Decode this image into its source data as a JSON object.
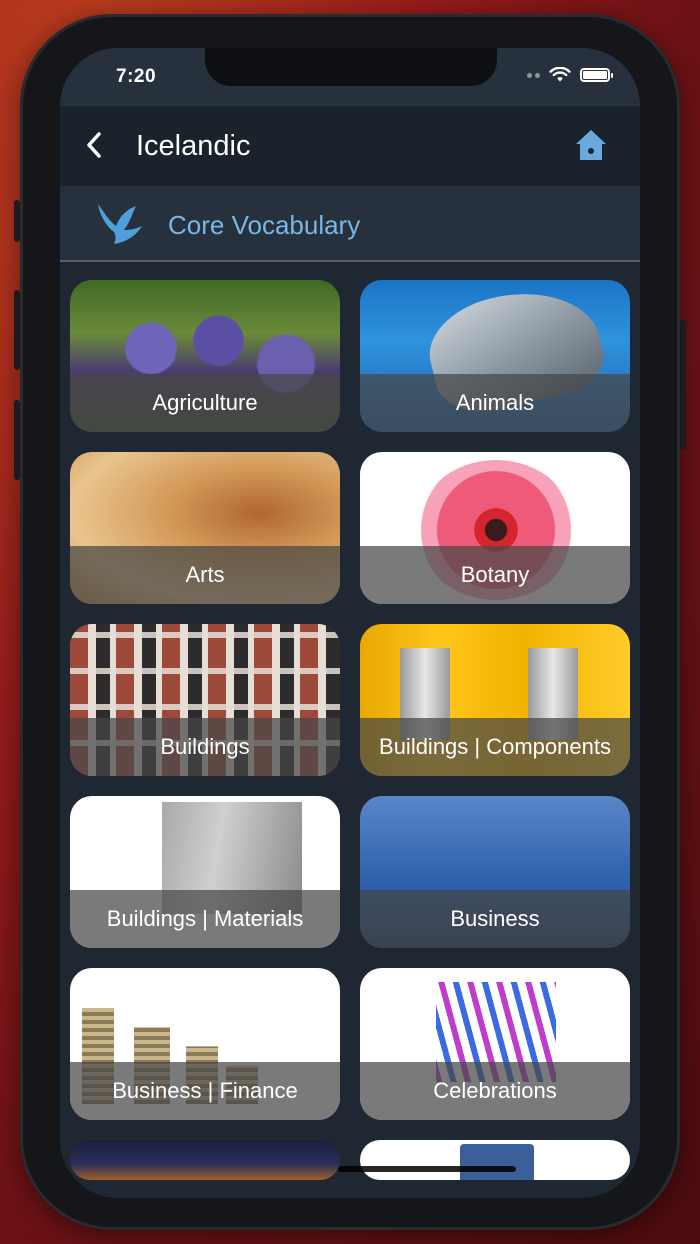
{
  "status_bar": {
    "time": "7:20"
  },
  "nav": {
    "title": "Icelandic",
    "back_icon": "chevron-left-icon",
    "home_icon": "house-icon"
  },
  "section": {
    "title": "Core Vocabulary",
    "icon": "bird-logo-icon"
  },
  "colors": {
    "accent": "#79b6e4",
    "nav_bg": "#1a222c",
    "content_bg": "#1e2732"
  },
  "categories": [
    {
      "label": "Agriculture"
    },
    {
      "label": "Animals"
    },
    {
      "label": "Arts"
    },
    {
      "label": "Botany"
    },
    {
      "label": "Buildings"
    },
    {
      "label": "Buildings | Components"
    },
    {
      "label": "Buildings | Materials"
    },
    {
      "label": "Business"
    },
    {
      "label": "Business | Finance"
    },
    {
      "label": "Celebrations"
    }
  ]
}
